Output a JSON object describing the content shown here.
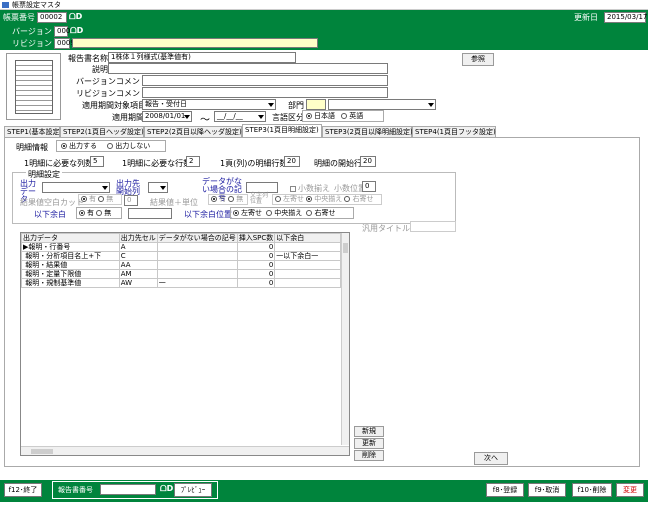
{
  "window": {
    "title": "帳票設定マスタ"
  },
  "header": {
    "form_no_label": "帳票番号",
    "form_no_value": "00002",
    "updated_label": "更新日",
    "updated_value": "2015/03/17",
    "version_label": "バージョン",
    "version_value": "000",
    "revision_label": "リビジョン",
    "revision_value": "0009"
  },
  "form": {
    "report_name_label": "報告書名称",
    "report_name_value": "1株体１列様式(基準値有)",
    "description_label": "説明",
    "version_comment_label": "バージョンコメント",
    "revision_comment_label": "リビジョンコメント",
    "period_target_label": "適用期間対象項目",
    "period_target_value": "報告・受付日",
    "department_label": "部門",
    "period_label": "適用期間",
    "period_from": "2008/01/01",
    "period_tilde": "～",
    "period_to": "__/__/__",
    "language_label": "言語区分",
    "lang_ja": "日本語",
    "lang_en": "英語",
    "browse_button": "参照"
  },
  "tabs": [
    {
      "label": "STEP1(基本設定)"
    },
    {
      "label": "STEP2(1頁目ヘッダ設定)"
    },
    {
      "label": "STEP2(2頁目以降ヘッダ設定)"
    },
    {
      "label": "STEP3(1頁目明細設定)"
    },
    {
      "label": "STEP3(2頁目以降明細設定)"
    },
    {
      "label": "STEP4(1頁目フッタ設定)"
    }
  ],
  "detail": {
    "info_label": "明細情報",
    "output_yes": "出力する",
    "output_no": "出力しない",
    "cols_label": "1明細に必要な列数",
    "cols_value": "5",
    "rows_label": "1明細に必要な行数",
    "rows_value": "2",
    "perpage_label": "1頁(列)の明細行数",
    "perpage_value": "20",
    "startrow_label": "明細の開始行",
    "startrow_value": "20",
    "settings_label": "明細設定",
    "output_data_label": "出力データ",
    "output_col_label": "出力先開始列",
    "nodata_label": "データがない場合の記号",
    "decimal_round_label": "小数揃え",
    "decimal_pos_label": "小数位置",
    "decimal_pos_value": "0",
    "result_blank_cut": "結果値空白カット",
    "has": "有",
    "none": "無",
    "result_unit": "結果値＋単位",
    "result_unit_value": "0",
    "has2": "有",
    "none2": "無",
    "char_align_label": "文字列位置",
    "left": "左寄せ",
    "center": "中央揃え",
    "right": "右寄せ",
    "below_blank_label": "以下余白",
    "below_has": "有",
    "below_none": "無",
    "below_pos_label": "以下余白位置",
    "bp_left": "左寄せ",
    "bp_center": "中央揃え",
    "bp_right": "右寄せ",
    "general_title_label": "汎用タイトル"
  },
  "grid": {
    "columns": [
      "出力データ",
      "出力先セル",
      "データがない場合の記号",
      "挿入SPC数",
      "以下余白"
    ],
    "rows": [
      [
        "報明・行番号",
        "A",
        "",
        "0",
        ""
      ],
      [
        "報明・分析項目名上+下",
        "C",
        "",
        "0",
        "一以下余白一"
      ],
      [
        "報明・結果値",
        "AA",
        "",
        "0",
        ""
      ],
      [
        "報明・定量下限値",
        "AM",
        "",
        "0",
        ""
      ],
      [
        "報明・規制基準値",
        "AW",
        "一",
        "0",
        ""
      ]
    ]
  },
  "side_buttons": {
    "new": "新規",
    "update": "更新",
    "delete": "削除"
  },
  "next_button": "次へ",
  "footer": {
    "f12": "f12･終了",
    "report_no_label": "報告書番号",
    "preview": "ﾌﾟﾚﾋﾞｭｰ",
    "f8": "f8･登録",
    "f9": "f9･取消",
    "f10": "f10･削除",
    "change": "変更"
  },
  "colors": {
    "accent": "#00843c",
    "change": "#d00000"
  }
}
